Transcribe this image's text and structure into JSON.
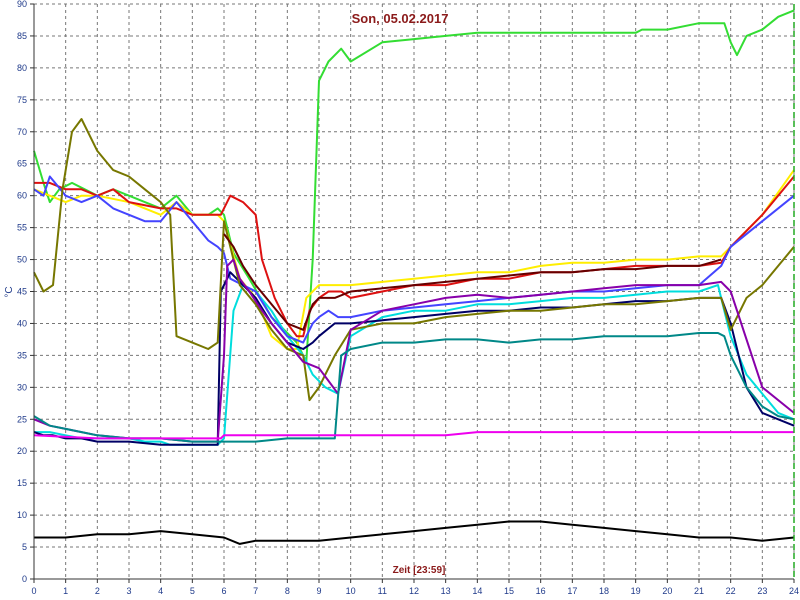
{
  "chart_data": {
    "type": "line",
    "title": "Son, 05.02.2017",
    "xlabel": "Zeit [23:59]",
    "ylabel": "°C",
    "xlim": [
      0,
      24
    ],
    "ylim": [
      0,
      90
    ],
    "x_ticks": [
      0,
      1,
      2,
      3,
      4,
      5,
      6,
      7,
      8,
      9,
      10,
      11,
      12,
      13,
      14,
      15,
      16,
      17,
      18,
      19,
      20,
      21,
      22,
      23,
      24
    ],
    "y_ticks": [
      0,
      5,
      10,
      15,
      20,
      25,
      30,
      35,
      40,
      45,
      50,
      55,
      60,
      65,
      70,
      75,
      80,
      85,
      90
    ],
    "grid": true,
    "end_marker_x": 24,
    "series": [
      {
        "color": "#33dd33",
        "x": [
          0,
          0.3,
          0.5,
          0.8,
          1.2,
          1.6,
          2,
          2.5,
          3,
          3.5,
          4,
          4.5,
          5,
          5.5,
          5.8,
          6,
          6.3,
          6.8,
          7.5,
          8.3,
          8.6,
          8.8,
          9,
          9.3,
          9.7,
          10,
          11,
          12,
          13,
          14,
          15,
          16,
          17,
          18,
          19,
          19.2,
          20,
          21,
          21.5,
          21.8,
          22,
          22.2,
          22.5,
          23,
          23.5,
          24
        ],
        "y": [
          67,
          62,
          59,
          61,
          62,
          61,
          60,
          61,
          60,
          59,
          58,
          60,
          57,
          57,
          58,
          57,
          51,
          47,
          41,
          37,
          34,
          50,
          78,
          81,
          83,
          81,
          84,
          84.5,
          85,
          85.5,
          85.5,
          85.5,
          85.5,
          85.5,
          85.5,
          86,
          86,
          87,
          87,
          87,
          84,
          82,
          85,
          86,
          88,
          89
        ]
      },
      {
        "color": "#ffee00",
        "x": [
          0,
          0.5,
          1,
          1.5,
          2,
          3,
          4,
          4.5,
          5,
          5.8,
          6,
          6.5,
          7,
          7.5,
          8,
          8.3,
          8.6,
          9,
          9.5,
          10,
          12,
          14,
          15,
          16,
          17,
          18,
          19,
          20,
          21,
          21.7,
          22,
          23,
          24
        ],
        "y": [
          61,
          60,
          59,
          60,
          60,
          59,
          57,
          59,
          57,
          57,
          56,
          47,
          44,
          38,
          36,
          36,
          44,
          46,
          46,
          46,
          47,
          48,
          48,
          49,
          49.5,
          49.5,
          50,
          50,
          50.5,
          50.5,
          52,
          57,
          64
        ]
      },
      {
        "color": "#dd1111",
        "x": [
          0,
          0.5,
          1,
          1.5,
          2,
          2.5,
          3,
          4,
          4.5,
          5,
          5.5,
          5.9,
          6.2,
          6.6,
          7,
          7.2,
          7.6,
          8,
          8.3,
          8.5,
          8.7,
          9,
          9.3,
          9.7,
          10,
          11,
          12,
          13,
          14,
          15,
          16,
          17,
          18,
          19,
          20,
          21,
          21.7,
          22,
          23,
          24
        ],
        "y": [
          62,
          62,
          61,
          61,
          60,
          61,
          59,
          58,
          58,
          57,
          57,
          57,
          60,
          59,
          57,
          50,
          44,
          40,
          38,
          38,
          42,
          44,
          45,
          45,
          44,
          45,
          46,
          46,
          47,
          47,
          48,
          48,
          48.5,
          49,
          49,
          49,
          49.5,
          52,
          57,
          63
        ]
      },
      {
        "color": "#00dddd",
        "x": [
          0,
          0.3,
          0.5,
          1,
          1.5,
          2,
          2.5,
          3,
          3.5,
          4,
          4.3,
          4.5,
          5,
          5.5,
          5.8,
          6,
          6.3,
          6.6,
          7,
          7.5,
          8,
          8.5,
          8.8,
          9.2,
          9.6,
          10,
          11,
          12,
          13,
          14,
          15,
          16,
          17,
          18,
          19,
          20,
          21,
          21.6,
          21.8,
          22,
          22.5,
          23,
          23.5,
          24
        ],
        "y": [
          23,
          23,
          23,
          22.5,
          22,
          22,
          22,
          22,
          21.5,
          21.5,
          21,
          21,
          21,
          21,
          21,
          22,
          42,
          46,
          45,
          42,
          38,
          35,
          32,
          30,
          29,
          38,
          41,
          42,
          42,
          43,
          43,
          43.5,
          44,
          44,
          44.5,
          45,
          45,
          46,
          42,
          38,
          32,
          29,
          26,
          25
        ]
      },
      {
        "color": "#4444ff",
        "x": [
          0,
          0.3,
          0.5,
          1,
          1.5,
          2,
          2.5,
          3,
          3.5,
          4,
          4.5,
          5,
          5.5,
          5.8,
          6,
          6.2,
          6.6,
          7,
          7.5,
          8,
          8.5,
          8.8,
          9,
          9.3,
          9.6,
          10,
          11,
          12,
          13,
          14,
          15,
          16,
          17,
          18,
          19,
          20,
          21,
          21.7,
          22,
          23,
          24
        ],
        "y": [
          61,
          60,
          63,
          60,
          59,
          60,
          58,
          57,
          56,
          56,
          59,
          56,
          53,
          52,
          51,
          47,
          46,
          45,
          41,
          38,
          37,
          40,
          41,
          42,
          41,
          41,
          42,
          42.5,
          43,
          43.5,
          44,
          44.5,
          45,
          45,
          45.5,
          46,
          46,
          49,
          52,
          56,
          60
        ]
      },
      {
        "color": "#000066",
        "x": [
          0,
          0.3,
          0.6,
          1,
          1.5,
          2,
          3,
          4,
          5,
          5.8,
          5.9,
          6.2,
          6.4,
          6.6,
          7,
          7.5,
          8,
          8.5,
          8.8,
          9,
          9.5,
          10,
          11,
          12,
          13,
          14,
          15,
          16,
          17,
          18,
          19,
          20,
          21,
          21.7,
          22,
          22.5,
          23,
          24
        ],
        "y": [
          23,
          22.5,
          22.5,
          22,
          22,
          21.5,
          21.5,
          21,
          21,
          21,
          45,
          48,
          47,
          46,
          44,
          40,
          37,
          36,
          37,
          38,
          40,
          40,
          40.5,
          41,
          41.5,
          42,
          42,
          42.5,
          42.5,
          43,
          43.5,
          43.5,
          44,
          44,
          40,
          30,
          26,
          24
        ]
      },
      {
        "color": "#777700",
        "x": [
          0,
          0.3,
          0.6,
          0.9,
          1.2,
          1.5,
          2,
          2.5,
          3,
          3.5,
          4,
          4.3,
          4.5,
          5,
          5.5,
          5.8,
          6,
          6.5,
          7,
          7.5,
          8,
          8.5,
          8.7,
          9,
          9.5,
          10,
          11,
          12,
          13,
          14,
          15,
          16,
          17,
          18,
          19,
          20,
          21,
          21.7,
          22,
          22.5,
          23,
          23.5,
          24
        ],
        "y": [
          48,
          45,
          46,
          61,
          70,
          72,
          67,
          64,
          63,
          61,
          59,
          57,
          38,
          37,
          36,
          37,
          56,
          46,
          43,
          39,
          36,
          35,
          28,
          30,
          35,
          39,
          40,
          40,
          41,
          41.5,
          42,
          42,
          42.5,
          43,
          43,
          43.5,
          44,
          44,
          39,
          44,
          46,
          49,
          52
        ]
      },
      {
        "color": "#8800aa",
        "x": [
          0,
          0.5,
          1,
          1.5,
          2,
          3,
          4,
          5,
          5.8,
          6,
          6.1,
          6.3,
          6.5,
          6.8,
          7.2,
          7.5,
          8,
          8.5,
          9,
          9.3,
          9.6,
          10,
          11,
          12,
          13,
          14,
          15,
          16,
          17,
          18,
          19,
          20,
          21,
          21.7,
          22,
          23,
          24
        ],
        "y": [
          25,
          24,
          23.5,
          23,
          22.5,
          22,
          22,
          21.5,
          21.5,
          35,
          49,
          50,
          47,
          45,
          42,
          40,
          37,
          34,
          33,
          31,
          29,
          39,
          42,
          43,
          44,
          44.5,
          44,
          44.5,
          45,
          45.5,
          46,
          46,
          46,
          46.5,
          45,
          30,
          26
        ]
      },
      {
        "color": "#008888",
        "x": [
          0,
          0.5,
          1,
          2,
          3,
          4,
          5,
          6,
          7,
          8,
          9,
          9.5,
          9.7,
          10,
          11,
          12,
          13,
          14,
          15,
          16,
          17,
          18,
          19,
          20,
          21,
          21.6,
          21.8,
          22,
          22.5,
          23,
          23.5,
          24
        ],
        "y": [
          25.5,
          24,
          23.5,
          22.5,
          22,
          22,
          21.5,
          21.5,
          21.5,
          22,
          22,
          22,
          35,
          36,
          37,
          37,
          37.5,
          37.5,
          37,
          37.5,
          37.5,
          38,
          38,
          38,
          38.5,
          38.5,
          38,
          35,
          30,
          27,
          25.5,
          25
        ]
      },
      {
        "color": "#660000",
        "x": [
          6,
          6.3,
          6.6,
          7,
          7.5,
          8,
          8.5,
          8.8,
          9,
          9.5,
          10,
          11,
          12,
          13,
          14,
          15,
          16,
          17,
          18,
          19,
          20,
          21,
          21.7
        ],
        "y": [
          54,
          52,
          49,
          46,
          43,
          40,
          39,
          43,
          44,
          44,
          45,
          45.5,
          46,
          46.5,
          47,
          47.5,
          48,
          48,
          48.5,
          48.5,
          49,
          49,
          50
        ]
      },
      {
        "color": "#ee00ee",
        "x": [
          0,
          2,
          4,
          5,
          5.9,
          6,
          9.5,
          10,
          12,
          13,
          14,
          16,
          18,
          20,
          22,
          24
        ],
        "y": [
          22.5,
          22,
          22,
          22,
          22,
          22.5,
          22.5,
          22.5,
          22.5,
          22.5,
          23,
          23,
          23,
          23,
          23,
          23
        ]
      },
      {
        "color": "#000000",
        "x": [
          0,
          1,
          2,
          3,
          4,
          5,
          6,
          6.5,
          7,
          8,
          9,
          10,
          11,
          12,
          13,
          14,
          15,
          16,
          17,
          18,
          19,
          20,
          21,
          22,
          23,
          24
        ],
        "y": [
          6.5,
          6.5,
          7,
          7,
          7.5,
          7,
          6.5,
          5.5,
          6,
          6,
          6,
          6.5,
          7,
          7.5,
          8,
          8.5,
          9,
          9,
          8.5,
          8,
          7.5,
          7,
          6.5,
          6.5,
          6,
          6.5
        ]
      }
    ]
  }
}
